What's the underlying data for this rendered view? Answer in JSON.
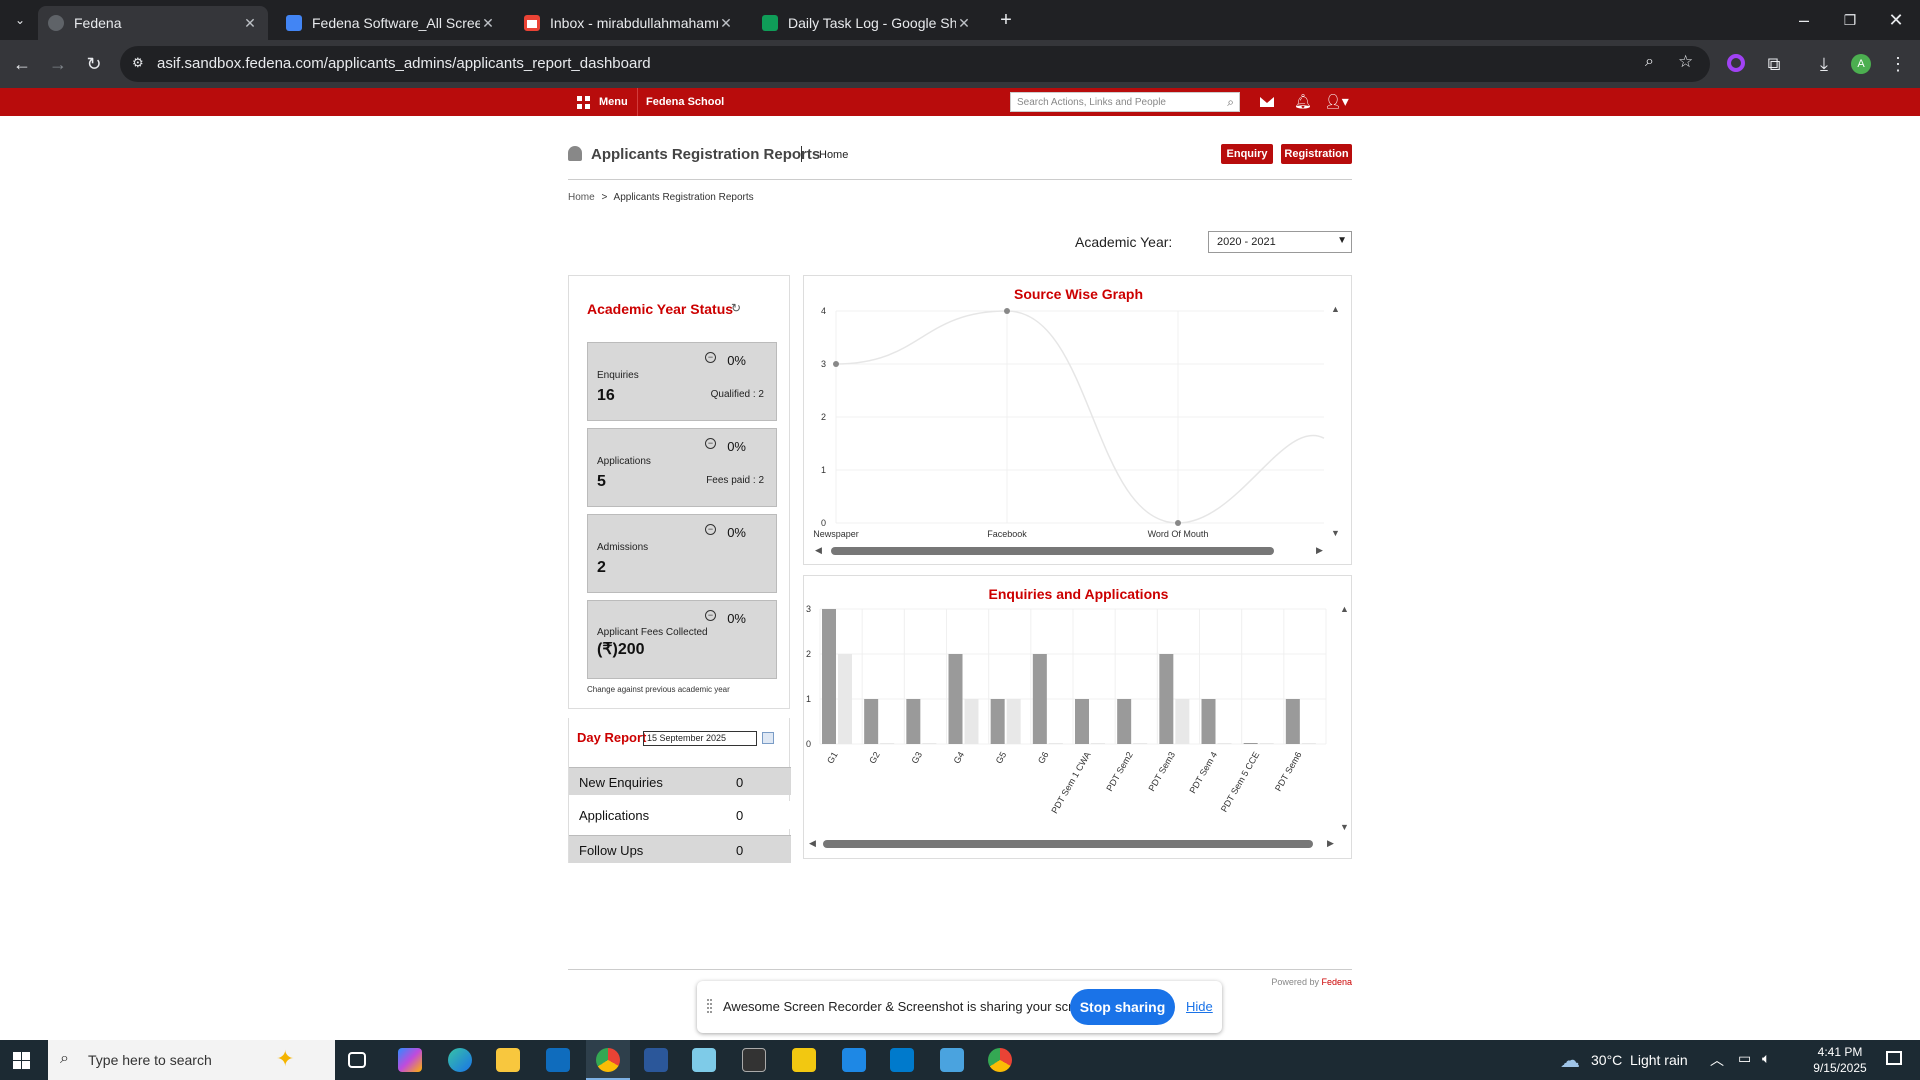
{
  "browser": {
    "tabs": [
      {
        "title": "Fedena",
        "active": true
      },
      {
        "title": "Fedena Software_All Screens - G"
      },
      {
        "title": "Inbox - mirabdullahmahammad"
      },
      {
        "title": "Daily Task Log - Google Sheets"
      }
    ],
    "url": "asif.sandbox.fedena.com/applicants_admins/applicants_report_dashboard",
    "profile_initial": "A"
  },
  "app": {
    "menu_label": "Menu",
    "school_name": "Fedena School",
    "search_placeholder": "Search Actions, Links and People"
  },
  "page": {
    "title": "Applicants Registration Reports",
    "title_link": "Home",
    "enquiry_button": "Enquiry",
    "registration_button": "Registration",
    "breadcrumb_home": "Home",
    "breadcrumb_sep": ">",
    "breadcrumb_current": "Applicants Registration Reports",
    "academic_year_label": "Academic Year:",
    "academic_year_value": "2020 - 2021"
  },
  "status": {
    "title": "Academic Year Status",
    "enquiries": {
      "label": "Enquiries",
      "value": "16",
      "pct": "0%",
      "sub": "Qualified : 2"
    },
    "applications": {
      "label": "Applications",
      "value": "5",
      "pct": "0%",
      "sub": "Fees paid : 2"
    },
    "admissions": {
      "label": "Admissions",
      "value": "2",
      "pct": "0%"
    },
    "fees": {
      "label": "Applicant Fees Collected",
      "value": "(₹)200",
      "pct": "0%"
    },
    "note": "Change against previous academic year"
  },
  "day_report": {
    "title": "Day Report",
    "date": "15 September 2025",
    "rows": [
      {
        "label": "New Enquiries",
        "value": "0"
      },
      {
        "label": "Applications",
        "value": "0"
      },
      {
        "label": "Follow Ups",
        "value": "0"
      }
    ]
  },
  "chart_data": [
    {
      "type": "line",
      "title": "Source Wise Graph",
      "categories": [
        "Newspaper",
        "Facebook",
        "Word Of Mouth"
      ],
      "values": [
        3,
        4,
        0
      ],
      "ylim": [
        0,
        4
      ],
      "yticks": [
        "0",
        "1",
        "2",
        "3",
        "4"
      ],
      "line_color": "#e6e6e6",
      "grid": true
    },
    {
      "type": "bar",
      "title": "Enquiries and Applications",
      "categories": [
        "G1",
        "G2",
        "G3",
        "G4",
        "G5",
        "G6",
        "PDT Sem 1 CWA",
        "PDT Sem2",
        "PDT Sem3",
        "PDT Sem 4",
        "PDT Sem 5 CCE",
        "PDT Sem6"
      ],
      "series": [
        {
          "values": [
            3,
            1,
            1,
            2,
            1,
            2,
            1,
            1,
            2,
            1,
            0,
            1
          ],
          "color": "#9a9a9a"
        },
        {
          "values": [
            2,
            0,
            0,
            1,
            1,
            0,
            0,
            0,
            1,
            0,
            0,
            0
          ],
          "color": "#e8e8e8"
        }
      ],
      "ylim": [
        0,
        3
      ],
      "yticks": [
        "0",
        "1",
        "2",
        "3"
      ],
      "grid": true
    }
  ],
  "footer": {
    "powered_by": "Powered by",
    "brand": "Fedena"
  },
  "share_bar": {
    "message": "Awesome Screen Recorder & Screenshot is sharing your screen.",
    "stop_button": "Stop sharing",
    "hide_link": "Hide"
  },
  "taskbar": {
    "search_placeholder": "Type here to search",
    "weather": "30°C  Light rain",
    "time": "4:41 PM",
    "date": "9/15/2025"
  }
}
